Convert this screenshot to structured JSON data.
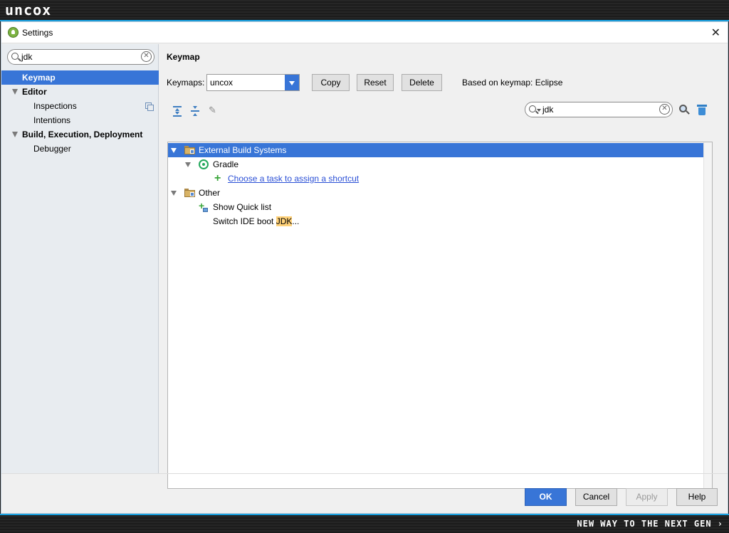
{
  "brand": {
    "logo": "uncox",
    "tagline": "NEW WAY TO THE NEXT GEN ›"
  },
  "window": {
    "title": "Settings"
  },
  "left": {
    "search_value": "jdk",
    "items": [
      {
        "label": "Keymap",
        "selected": true
      },
      {
        "label": "Editor"
      },
      {
        "label": "Inspections"
      },
      {
        "label": "Intentions"
      },
      {
        "label": "Build, Execution, Deployment"
      },
      {
        "label": "Debugger"
      }
    ]
  },
  "keymap": {
    "title": "Keymap",
    "label": "Keymaps:",
    "selected": "uncox",
    "copy_label": "Copy",
    "reset_label": "Reset",
    "delete_label": "Delete",
    "based_on": "Based on keymap: Eclipse",
    "filter_value": "jdk"
  },
  "tree": {
    "rows": [
      {
        "label": "External Build Systems",
        "selected": true
      },
      {
        "label": "Gradle"
      },
      {
        "label": "Choose a task to assign a shortcut"
      },
      {
        "label": "Other"
      },
      {
        "label": "Show Quick list"
      },
      {
        "label_prefix": "Switch IDE boot ",
        "label_highlight": "JDK",
        "label_suffix": "..."
      }
    ]
  },
  "footer": {
    "ok_label": "OK",
    "cancel_label": "Cancel",
    "apply_label": "Apply",
    "help_label": "Help"
  },
  "colors": {
    "accent": "#3875d7",
    "highlight": "#ffd27a",
    "frame_edge": "#1aa1e0"
  }
}
